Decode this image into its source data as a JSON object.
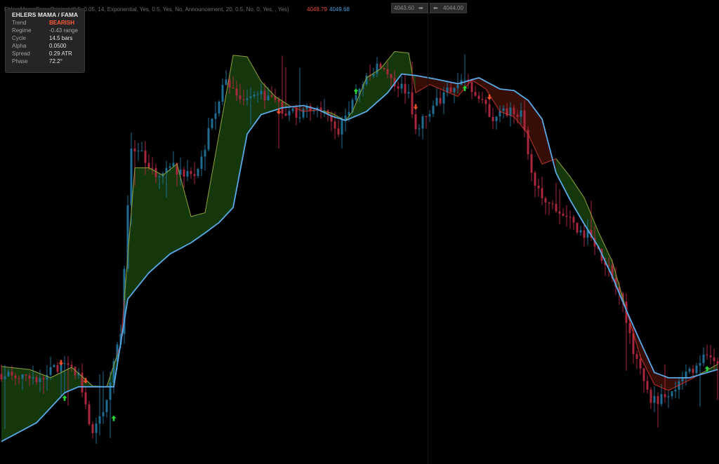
{
  "header": {
    "indicator_params": "EhlersMamaFamaOriginal (0.5, 0.05, 14, Exponential, Yes, 0.5, Yes, No, Announcement, 20, 0.5, No, 0, Yes, , Yes)",
    "value_red": "4048.79",
    "value_blue": "4049.68"
  },
  "price_boxes": {
    "left": {
      "value": "4043.60",
      "arrow": "➡"
    },
    "right": {
      "value": "4044.00",
      "arrow": "⬅"
    }
  },
  "info_panel": {
    "title": "EHLERS MAMA / FAMA",
    "rows": [
      {
        "label": "Trend",
        "value": "BEARISH"
      },
      {
        "label": "Regime",
        "value": "-0.43  range"
      },
      {
        "label": "Cycle",
        "value": "14.5 bars"
      },
      {
        "label": "Alpha",
        "value": "0.0500"
      },
      {
        "label": "Spread",
        "value": "0.29 ATR"
      },
      {
        "label": "Phase",
        "value": "72.2°"
      }
    ]
  },
  "colors": {
    "background": "#000000",
    "bull_candle": "#1f6d93",
    "bear_candle": "#a9283e",
    "mama_line": "#5aa9e8",
    "fama_line": "#d93a32",
    "bull_band_fill": "#163a0d",
    "bull_band_edge": "#6fba3c",
    "bear_band_fill": "#3a0f06",
    "buy_arrow": "#27d63a",
    "sell_arrow": "#f0502d"
  },
  "chart_data": {
    "type": "candlestick",
    "title": "",
    "y_range": [
      4000,
      4060
    ],
    "grid": false,
    "legend": "none",
    "num_bars": 205,
    "segments": [
      [
        0,
        4012.0
      ],
      [
        10,
        4011.5
      ],
      [
        18,
        4013.3
      ],
      [
        22,
        4011.5
      ],
      [
        26,
        4004.0
      ],
      [
        30,
        4008.6
      ],
      [
        34,
        4017.5
      ],
      [
        37,
        4042.0
      ],
      [
        40,
        4041.5
      ],
      [
        44,
        4038.0
      ],
      [
        48,
        4040.0
      ],
      [
        52,
        4038.4
      ],
      [
        56,
        4039.0
      ],
      [
        60,
        4046.0
      ],
      [
        64,
        4051.5
      ],
      [
        68,
        4048.5
      ],
      [
        72,
        4049.5
      ],
      [
        76,
        4048.9
      ],
      [
        80,
        4047.3
      ],
      [
        84,
        4046.7
      ],
      [
        88,
        4047.2
      ],
      [
        92,
        4047.6
      ],
      [
        96,
        4044.3
      ],
      [
        100,
        4048.5
      ],
      [
        104,
        4052.0
      ],
      [
        108,
        4053.0
      ],
      [
        112,
        4051.0
      ],
      [
        116,
        4049.1
      ],
      [
        118,
        4044.3
      ],
      [
        120,
        4046.2
      ],
      [
        124,
        4048.3
      ],
      [
        128,
        4050.0
      ],
      [
        132,
        4051.0
      ],
      [
        135,
        4049.7
      ],
      [
        140,
        4046.0
      ],
      [
        144,
        4047.0
      ],
      [
        148,
        4046.5
      ],
      [
        152,
        4037.0
      ],
      [
        156,
        4035.0
      ],
      [
        160,
        4033.4
      ],
      [
        164,
        4031.2
      ],
      [
        168,
        4030.3
      ],
      [
        172,
        4026.7
      ],
      [
        176,
        4023.3
      ],
      [
        178,
        4018.9
      ],
      [
        181,
        4013.5
      ],
      [
        185,
        4008.3
      ],
      [
        190,
        4009.0
      ],
      [
        195,
        4012.0
      ],
      [
        200,
        4014.0
      ],
      [
        204,
        4013.3
      ]
    ],
    "mama": [
      [
        0,
        4003.0
      ],
      [
        10,
        4005.5
      ],
      [
        18,
        4009.5
      ],
      [
        22,
        4010.3
      ],
      [
        26,
        4010.3
      ],
      [
        32,
        4010.3
      ],
      [
        36,
        4022.0
      ],
      [
        42,
        4025.5
      ],
      [
        48,
        4028.0
      ],
      [
        54,
        4029.5
      ],
      [
        58,
        4030.8
      ],
      [
        62,
        4032.2
      ],
      [
        66,
        4034.2
      ],
      [
        70,
        4044.0
      ],
      [
        74,
        4046.6
      ],
      [
        80,
        4047.5
      ],
      [
        86,
        4047.8
      ],
      [
        90,
        4047.3
      ],
      [
        94,
        4046.4
      ],
      [
        98,
        4045.8
      ],
      [
        104,
        4047.0
      ],
      [
        110,
        4049.5
      ],
      [
        114,
        4052.0
      ],
      [
        118,
        4051.8
      ],
      [
        124,
        4051.3
      ],
      [
        130,
        4050.7
      ],
      [
        136,
        4051.5
      ],
      [
        142,
        4050.0
      ],
      [
        146,
        4049.8
      ],
      [
        150,
        4048.5
      ],
      [
        154,
        4046.0
      ],
      [
        158,
        4038.8
      ],
      [
        162,
        4035.2
      ],
      [
        166,
        4032.0
      ],
      [
        170,
        4029.0
      ],
      [
        174,
        4025.0
      ],
      [
        178,
        4020.5
      ],
      [
        182,
        4016.3
      ],
      [
        186,
        4012.2
      ],
      [
        190,
        4011.5
      ],
      [
        196,
        4011.5
      ],
      [
        204,
        4012.6
      ]
    ],
    "fama": [
      [
        0,
        4013.0
      ],
      [
        8,
        4012.6
      ],
      [
        14,
        4011.5
      ],
      [
        20,
        4012.9
      ],
      [
        26,
        4010.4
      ],
      [
        30,
        4010.3
      ],
      [
        34,
        4016.0
      ],
      [
        38,
        4039.5
      ],
      [
        42,
        4039.5
      ],
      [
        46,
        4038.5
      ],
      [
        50,
        4040.0
      ],
      [
        54,
        4033.0
      ],
      [
        58,
        4033.5
      ],
      [
        62,
        4044.0
      ],
      [
        66,
        4054.5
      ],
      [
        70,
        4054.3
      ],
      [
        74,
        4051.0
      ],
      [
        78,
        4049.0
      ],
      [
        82,
        4047.8
      ],
      [
        86,
        4047.0
      ],
      [
        90,
        4047.2
      ],
      [
        94,
        4046.8
      ],
      [
        98,
        4045.8
      ],
      [
        100,
        4047.0
      ],
      [
        104,
        4051.5
      ],
      [
        108,
        4052.7
      ],
      [
        112,
        4055.0
      ],
      [
        116,
        4054.8
      ],
      [
        118,
        4049.5
      ],
      [
        122,
        4050.6
      ],
      [
        126,
        4049.8
      ],
      [
        130,
        4049.0
      ],
      [
        134,
        4051.2
      ],
      [
        138,
        4050.0
      ],
      [
        142,
        4047.0
      ],
      [
        146,
        4046.3
      ],
      [
        150,
        4044.0
      ],
      [
        154,
        4040.0
      ],
      [
        158,
        4040.7
      ],
      [
        162,
        4038.3
      ],
      [
        166,
        4035.5
      ],
      [
        170,
        4031.0
      ],
      [
        174,
        4027.0
      ],
      [
        178,
        4020.5
      ],
      [
        182,
        4014.3
      ],
      [
        186,
        4010.6
      ],
      [
        190,
        4009.8
      ],
      [
        196,
        4011.2
      ],
      [
        204,
        4013.3
      ]
    ],
    "buy_signals": [
      [
        18,
        4008.8
      ],
      [
        32,
        4006.1
      ],
      [
        101,
        4049.7
      ],
      [
        132,
        4050.1
      ],
      [
        201,
        4012.7
      ]
    ],
    "sell_signals": [
      [
        17,
        4013.5
      ],
      [
        24,
        4011.1
      ],
      [
        79,
        4047.0
      ],
      [
        118,
        4047.6
      ],
      [
        139,
        4048.9
      ]
    ]
  }
}
